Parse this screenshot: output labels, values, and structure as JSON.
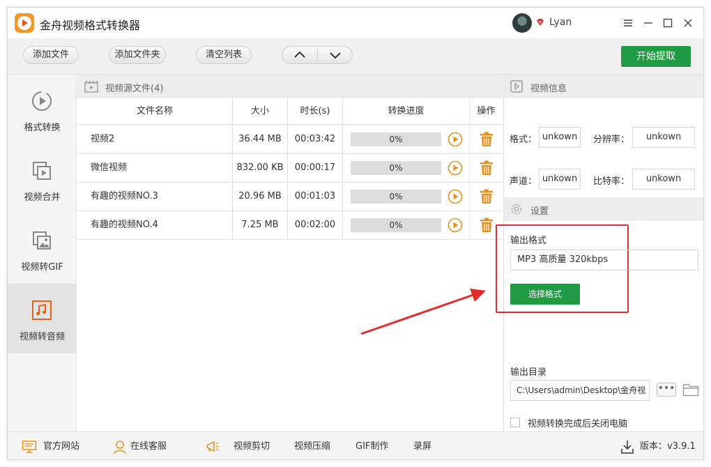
{
  "title_bar": {
    "app_title": "金舟视频格式转换器",
    "username": "Lyan"
  },
  "toolbar": {
    "add_file": "添加文件",
    "add_folder": "添加文件夹",
    "clear_list": "清空列表",
    "start": "开始提取"
  },
  "sidebar": {
    "items": [
      {
        "label": "格式转换",
        "icon": "format-convert-icon"
      },
      {
        "label": "视频合并",
        "icon": "video-merge-icon"
      },
      {
        "label": "视频转GIF",
        "icon": "video-to-gif-icon"
      },
      {
        "label": "视频转音频",
        "icon": "video-to-audio-icon",
        "active": true
      }
    ]
  },
  "file_panel": {
    "header": "视频源文件(4)",
    "columns": [
      "文件名称",
      "大小",
      "时长(s)",
      "转换进度",
      "操作"
    ],
    "rows": [
      {
        "name": "视频2",
        "size": "36.44 MB",
        "duration": "00:03:42",
        "progress_text": "0%",
        "progress": 0
      },
      {
        "name": "微信视频",
        "size": "832.00 KB",
        "duration": "00:00:17",
        "progress_text": "0%",
        "progress": 0
      },
      {
        "name": "有趣的视频NO.3",
        "size": "20.96 MB",
        "duration": "00:01:03",
        "progress_text": "0%",
        "progress": 0
      },
      {
        "name": "有趣的视频NO.4",
        "size": "7.25 MB",
        "duration": "00:02:00",
        "progress_text": "0%",
        "progress": 0
      }
    ]
  },
  "video_info": {
    "header": "视频信息",
    "format_label": "格式：",
    "format_value": "unkown",
    "resolution_label": "分辨率：",
    "resolution_value": "unkown",
    "channel_label": "声道：",
    "channel_value": "unkown",
    "bitrate_label": "比特率：",
    "bitrate_value": "unkown"
  },
  "settings": {
    "header": "设置",
    "output_format_label": "输出格式",
    "output_format_value": "MP3 高质量 320kbps",
    "choose_format": "选择格式",
    "output_dir_label": "输出目录",
    "output_dir_value": "C:\\Users\\admin\\Desktop\\金舟视",
    "more_label": "•••",
    "shutdown_label": "视频转换完成后关闭电脑",
    "shutdown_checked": false
  },
  "footer": {
    "website": "官方网站",
    "support": "在线客服",
    "video_cut": "视频剪切",
    "video_compress": "视频压缩",
    "gif_make": "GIF制作",
    "screen_record": "录屏",
    "version": "版本：v3.9.1"
  },
  "colors": {
    "accent_green": "#1f9c43",
    "logo_orange": "#f39a24",
    "trash_orange": "#e8901d",
    "annotation_red": "#e52b2b"
  }
}
